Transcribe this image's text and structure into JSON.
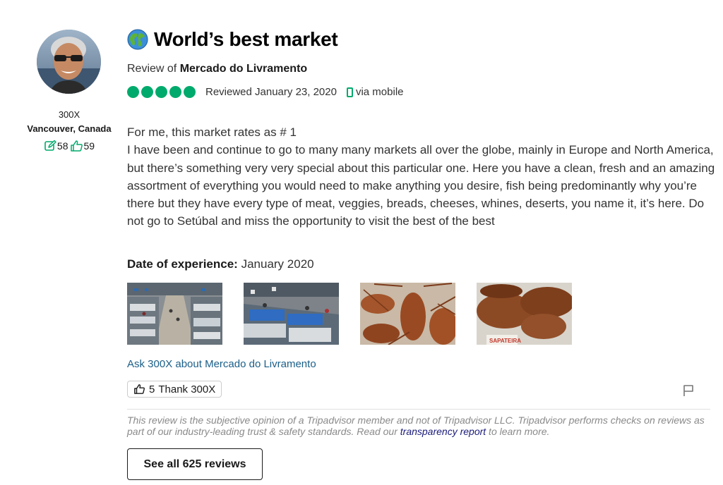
{
  "reviewer": {
    "username": "300X",
    "location": "Vancouver, Canada",
    "contributions": "58",
    "helpful_votes": "59",
    "avatar_icon": "avatar-photo"
  },
  "review": {
    "title": "World’s best market",
    "title_icon": "globe-icon",
    "review_of_prefix": "Review of",
    "place": "Mercado do Livramento",
    "rating": 5,
    "rating_max": 5,
    "reviewed_date": "Reviewed January 23, 2020",
    "via": "via mobile",
    "body_line1": "For me, this market rates as # 1",
    "body_line2": "I have been and continue to go to many many markets all over the globe, mainly in Europe and North America, but there’s something very very special about this particular one. Here you have a clean, fresh and an amazing assortment of everything you would need to make anything you desire, fish being predominantly why you’re there but they have every type of meat, veggies, breads, cheeses, whines, deserts, you name it, it’s here. Do not go to Setúbal and miss the opportunity to visit the best of the best",
    "date_of_experience_label": "Date of experience:",
    "date_of_experience": "January 2020",
    "photo_sign_text": "SAPATEIRA"
  },
  "actions": {
    "ask_link": "Ask 300X about Mercado do Livramento",
    "thank_count": "5",
    "thank_label": "Thank 300X",
    "see_all": "See all 625 reviews"
  },
  "disclaimer": {
    "text_before": "This review is the subjective opinion of a Tripadvisor member and not of Tripadvisor LLC. Tripadvisor performs checks on reviews as part of our industry-leading trust & safety standards. Read our ",
    "link": "transparency report",
    "text_after": " to learn more."
  },
  "colors": {
    "bubble": "#00aa6c",
    "link": "#1a5e88",
    "disclaimer_link": "#1a1a7a"
  }
}
